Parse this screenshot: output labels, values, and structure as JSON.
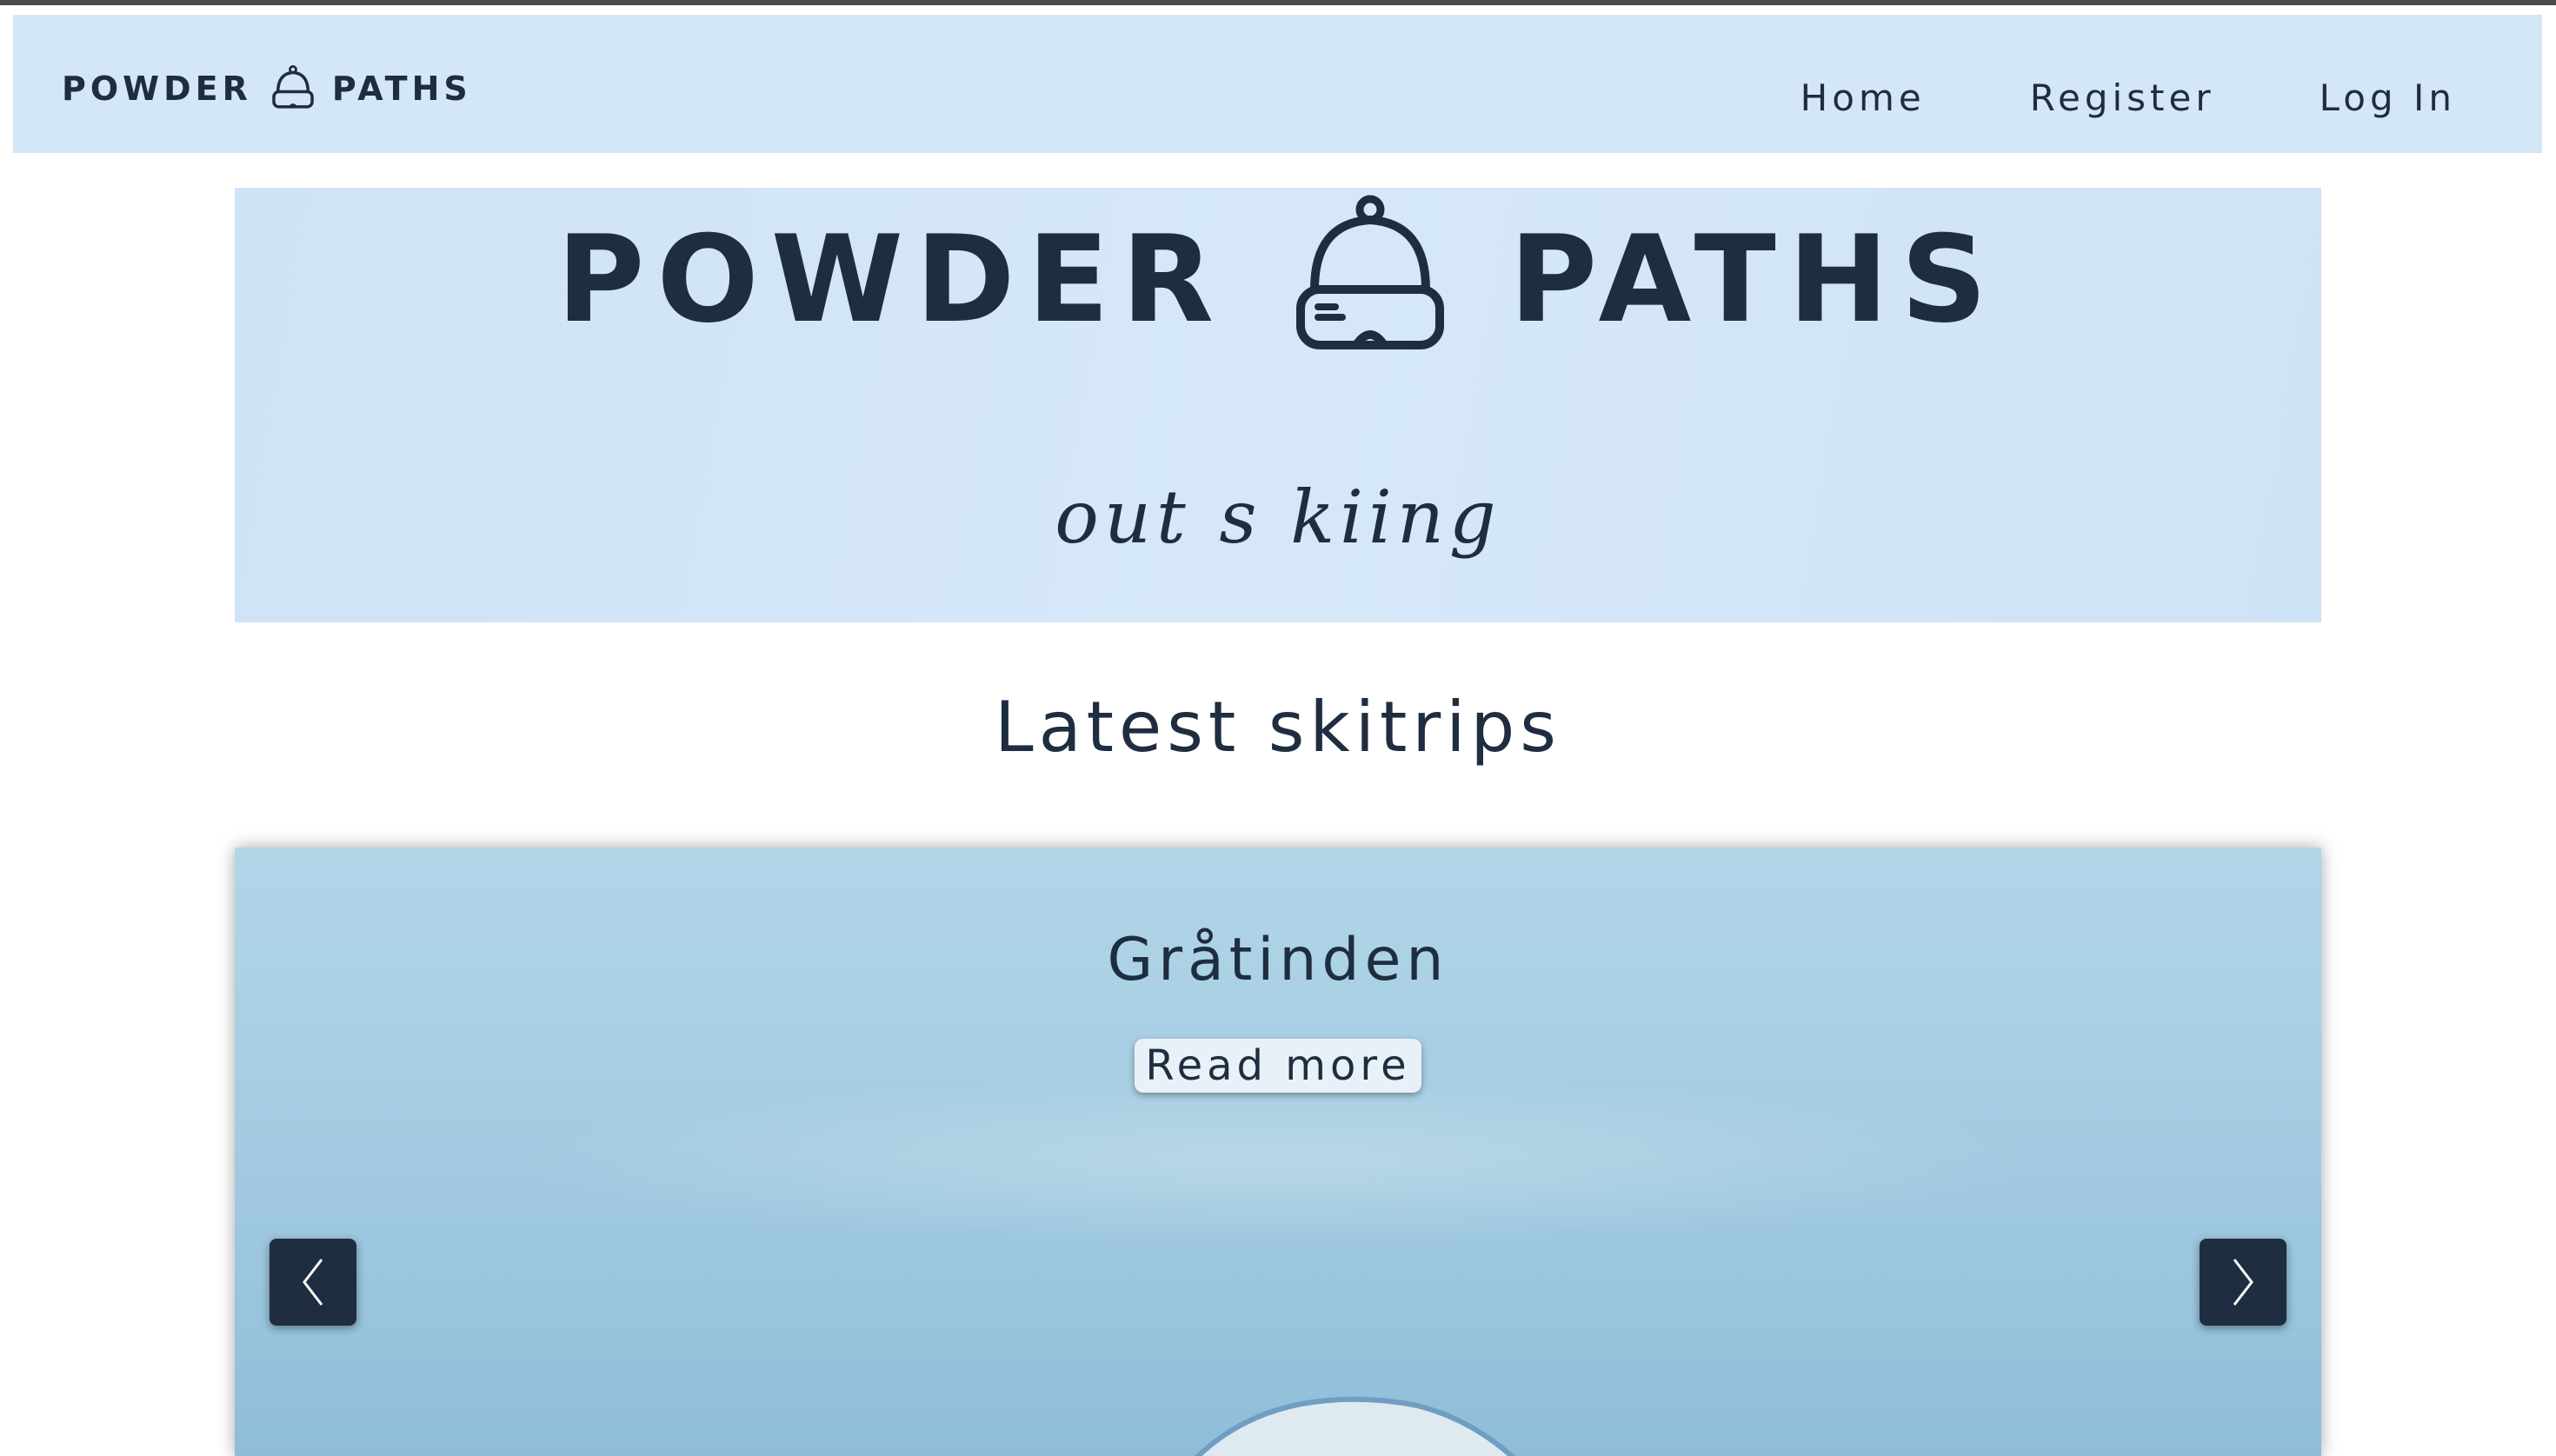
{
  "navbar": {
    "logo_left": "POWDER",
    "logo_right": "PATHS",
    "logo_icon": "ski-helmet-goggles-icon",
    "links": [
      {
        "label": "Home"
      },
      {
        "label": "Register"
      },
      {
        "label": "Log In"
      }
    ]
  },
  "hero": {
    "title_left": "POWDER",
    "title_right": "PATHS",
    "icon": "ski-helmet-goggles-icon",
    "tagline": "out s kiing"
  },
  "section": {
    "heading": "Latest skitrips"
  },
  "carousel": {
    "slide_title": "Gråtinden",
    "read_more_label": "Read more",
    "prev_icon": "chevron-left-icon",
    "next_icon": "chevron-right-icon"
  },
  "colors": {
    "brand_dark": "#1f2d40",
    "navbar_bg": "#d4e7f7",
    "hero_bg": "#d3e6f7",
    "sky": "#a6cde2"
  }
}
